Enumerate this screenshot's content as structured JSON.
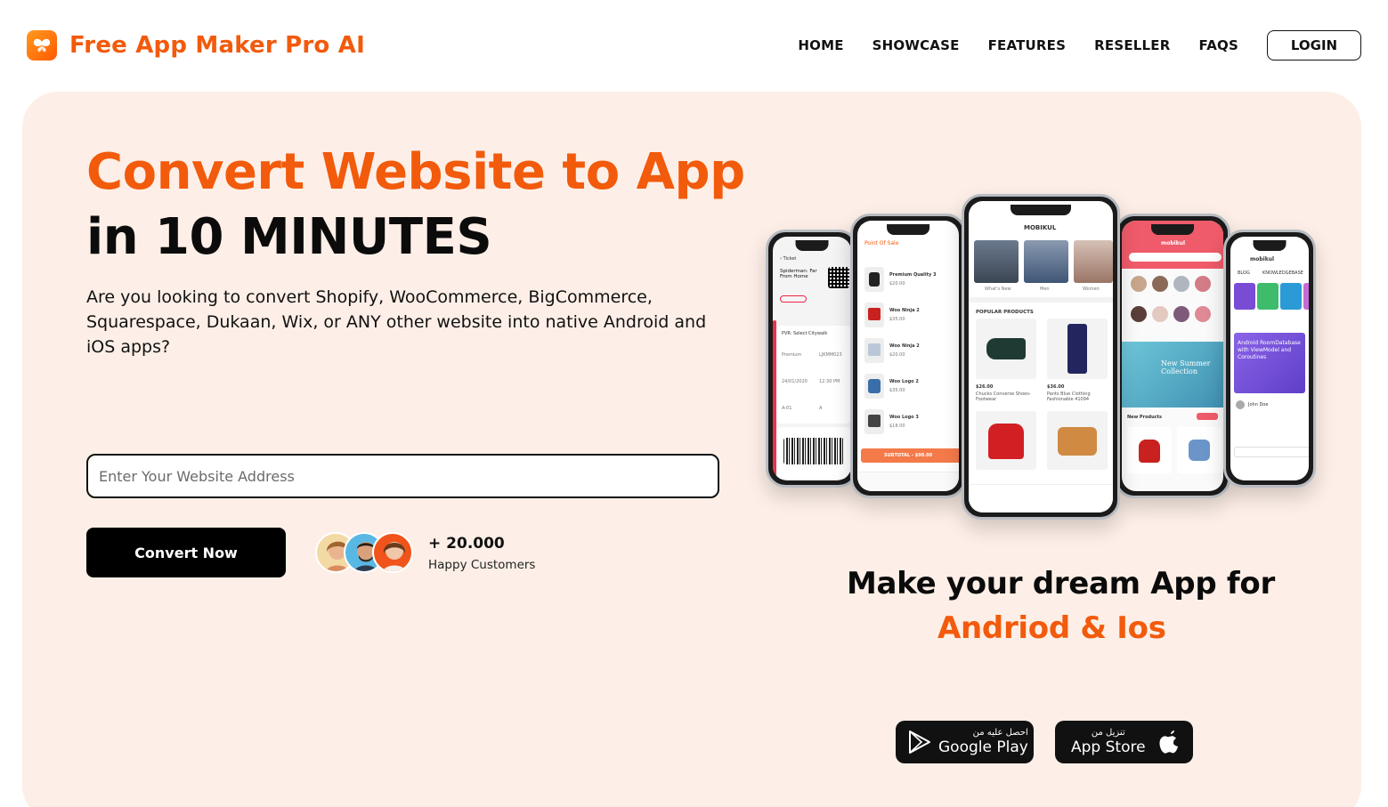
{
  "header": {
    "brand": "Free App Maker Pro AI",
    "logo_icon": "butterfly-icon",
    "nav": [
      "HOME",
      "SHOWCASE",
      "FEATURES",
      "RESELLER",
      "FAQS"
    ],
    "login_label": "LOGIN"
  },
  "hero": {
    "headline_line1": "Convert Website to App",
    "headline_line2": "in 10 MINUTES",
    "subtext": "Are you looking to convert Shopify, WooCommerce, BigCommerce, Squarespace, Dukaan, Wix, or ANY other website into native Android and iOS apps?",
    "input_placeholder": "Enter Your Website Address",
    "convert_label": "Convert Now",
    "customers_count": "+ 20.000",
    "customers_label": "Happy Customers",
    "tagline_line1": "Make your dream App for",
    "tagline_line2": "Andriod & Ios"
  },
  "stores": {
    "google_play_small": "احصل عليه من",
    "google_play_big": "Google Play",
    "app_store_small": "تنزيل من",
    "app_store_big": "App Store"
  },
  "phones": {
    "center_title": "MOBIKUL",
    "center_section": "POPULAR PRODUCTS",
    "center_products": [
      {
        "price": "$26.00",
        "name": "Chucks Converse Shoes-Footwear"
      },
      {
        "price": "$36.00",
        "name": "Pants Blue Clothing Fashionable 41094"
      }
    ],
    "center_categories": [
      "What's New",
      "Men",
      "Women"
    ],
    "pos_title": "Point Of Sale",
    "pos_items": [
      {
        "name": "Premium Quality 3",
        "price": "$20.00"
      },
      {
        "name": "Woo Ninja 2",
        "price": "$35.00"
      },
      {
        "name": "Woo Ninja 2",
        "price": "$20.00"
      },
      {
        "name": "Woo Logo 2",
        "price": "$35.00"
      },
      {
        "name": "Woo Logo 3",
        "price": "$18.00"
      }
    ],
    "pos_subtotal": "SUBTOTAL - $90.00",
    "ticket_title": "Ticket",
    "ticket_movie": "Spiderman: Far From Home",
    "ticket_venue": "PVR: Select Citywalk",
    "ticket_category": "Premium",
    "ticket_order": "LJKMM023",
    "ticket_date": "24/01/2020",
    "ticket_time": "12:30 PM",
    "ticket_audi": "A-01",
    "ticket_row": "A",
    "store_brand": "mobikul",
    "store_banner": "New Summer Collection",
    "store_section": "New Products",
    "blog_brand": "mobikul",
    "blog_tabs": [
      "BLOG",
      "KNOWLEDGEBASE"
    ],
    "blog_post": "Android RoomDatabase with ViewModel and Coroutines",
    "blog_author": "John Doe"
  },
  "colors": {
    "accent": "#f25a0c",
    "hero_bg": "#fdefe7",
    "dark": "#000000"
  }
}
